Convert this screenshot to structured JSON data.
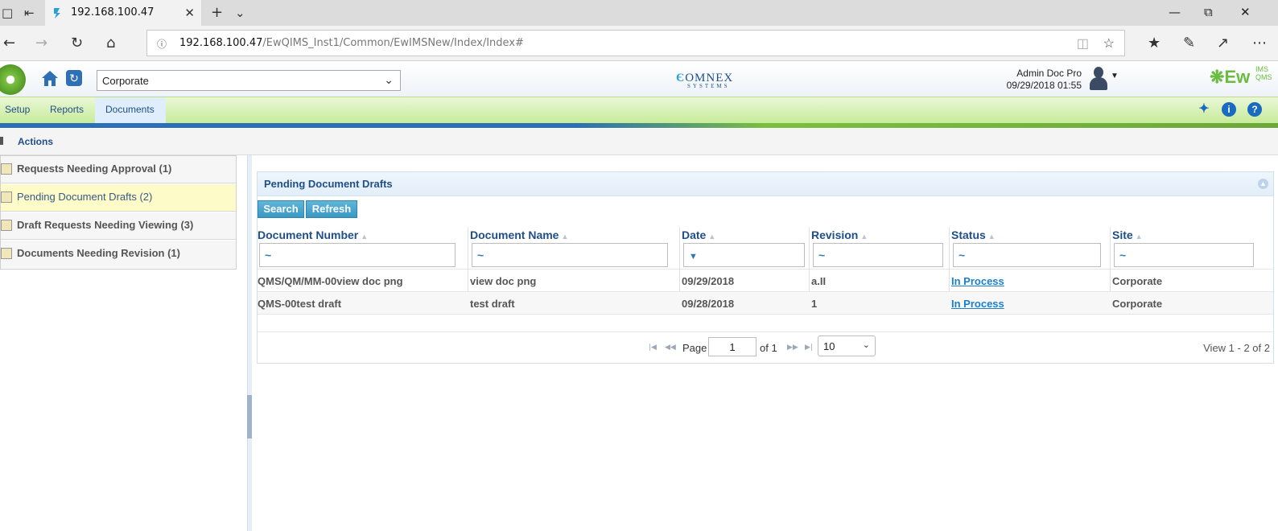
{
  "browser": {
    "tab_title": "192.168.100.47",
    "address_host": "192.168.100.47",
    "address_path": "/EwQIMS_Inst1/Common/EwIMSNew/Index/Index#"
  },
  "header": {
    "site_selected": "Corporate",
    "brand_center": "OMNEX",
    "brand_center_sub": "SYSTEMS",
    "user_name": "Admin Doc Pro",
    "user_datetime": "09/29/2018 01:55",
    "brand_right": "Ew",
    "brand_right_sup": "IMS",
    "brand_right_sub": "QMS"
  },
  "menu": {
    "items": [
      {
        "label": "Setup"
      },
      {
        "label": "Reports"
      },
      {
        "label": "Documents"
      }
    ]
  },
  "breadcrumb": {
    "current": "Actions"
  },
  "sidebar": {
    "items": [
      {
        "label": "Requests Needing Approval (1)"
      },
      {
        "label": "Pending Document Drafts (2)"
      },
      {
        "label": "Draft Requests Needing Viewing (3)"
      },
      {
        "label": "Documents Needing Revision (1)"
      }
    ]
  },
  "grid": {
    "title": "Pending Document Drafts",
    "search_label": "Search",
    "refresh_label": "Refresh",
    "columns": [
      "Document Number",
      "Document Name",
      "Date",
      "Revision",
      "Status",
      "Site"
    ],
    "filter_symbols": [
      "~",
      "~",
      "",
      "~",
      "~",
      "~"
    ],
    "rows": [
      [
        "QMS/QM/MM-00view doc png",
        "view doc png",
        "09/29/2018",
        "a.II",
        "In Process",
        "Corporate"
      ],
      [
        "QMS-00test draft",
        "test draft",
        "09/28/2018",
        "1",
        "In Process",
        "Corporate"
      ]
    ],
    "pager": {
      "page_label": "Page",
      "page_value": "1",
      "of_label": "of 1",
      "page_size": "10",
      "view_text": "View 1 - 2 of 2"
    }
  },
  "colors": {
    "accent_blue": "#1f4e8a",
    "menubar_green": "#c7eb9a",
    "link_blue": "#1a7fd0",
    "button_blue": "#3a98c4",
    "active_row_yellow": "#fdfbc8"
  }
}
